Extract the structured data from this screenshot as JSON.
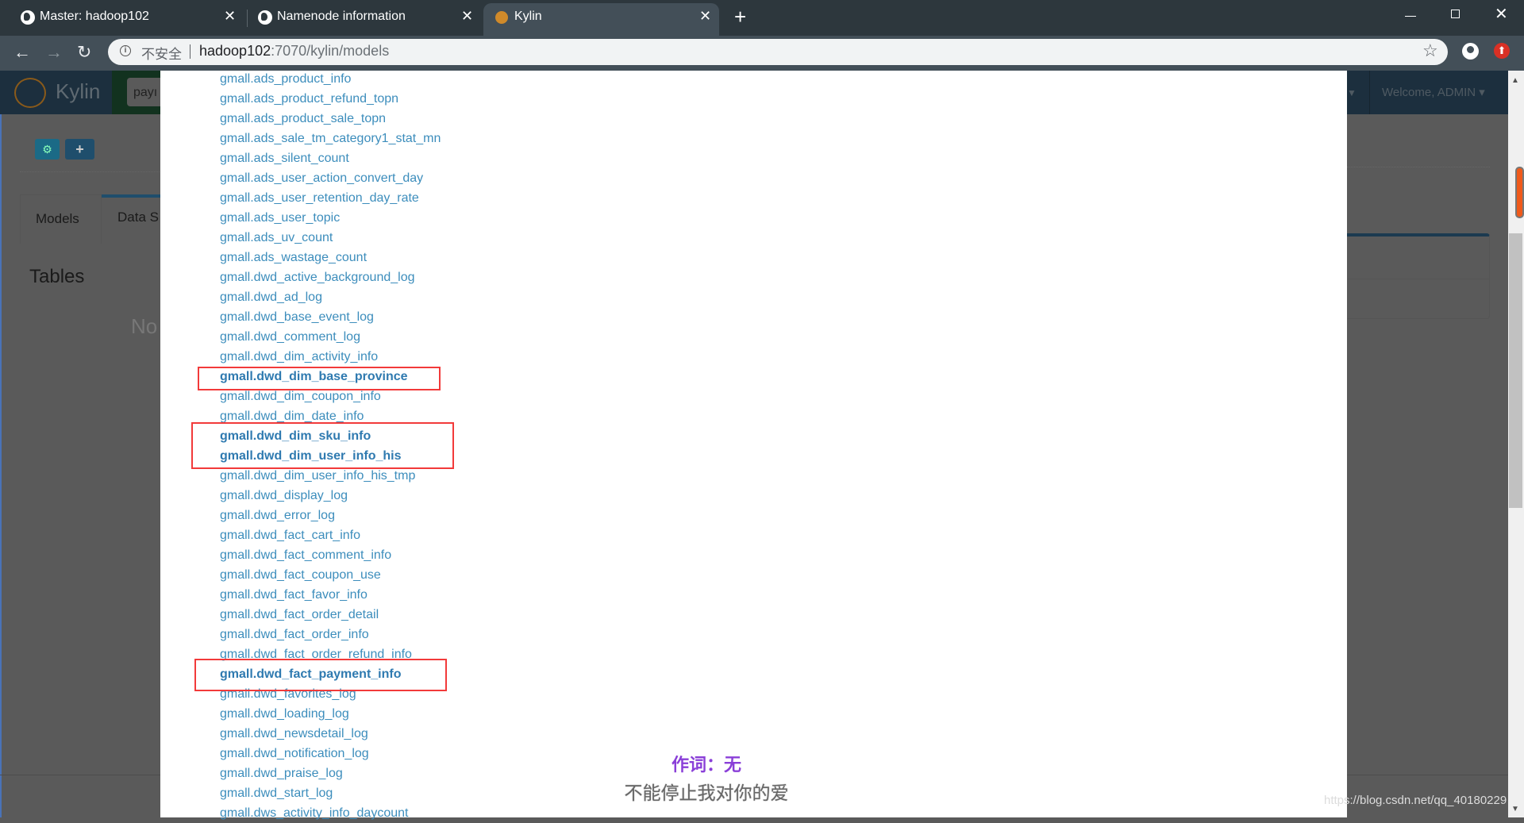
{
  "browser": {
    "tabs": [
      {
        "title": "Master: hadoop102",
        "icon": "globe-icon",
        "close": "✕"
      },
      {
        "title": "Namenode information",
        "icon": "globe-icon",
        "close": "✕"
      },
      {
        "title": "Kylin",
        "icon": "kylin-logo-icon",
        "close": "✕",
        "active": true
      }
    ],
    "new_tab": "+",
    "security_label": "不安全",
    "url_host": "hadoop102",
    "url_path": ":7070/kylin/models"
  },
  "kylin": {
    "brand": "Kylin",
    "project_select": "payı",
    "welcome": "Welcome, ADMIN",
    "tabs": [
      "Models",
      "Data S"
    ],
    "tables_heading": "Tables",
    "no_text": "No"
  },
  "table_list": [
    {
      "name": "gmall.ads_product_info"
    },
    {
      "name": "gmall.ads_product_refund_topn"
    },
    {
      "name": "gmall.ads_product_sale_topn"
    },
    {
      "name": "gmall.ads_sale_tm_category1_stat_mn"
    },
    {
      "name": "gmall.ads_silent_count"
    },
    {
      "name": "gmall.ads_user_action_convert_day"
    },
    {
      "name": "gmall.ads_user_retention_day_rate"
    },
    {
      "name": "gmall.ads_user_topic"
    },
    {
      "name": "gmall.ads_uv_count"
    },
    {
      "name": "gmall.ads_wastage_count"
    },
    {
      "name": "gmall.dwd_active_background_log"
    },
    {
      "name": "gmall.dwd_ad_log"
    },
    {
      "name": "gmall.dwd_base_event_log"
    },
    {
      "name": "gmall.dwd_comment_log"
    },
    {
      "name": "gmall.dwd_dim_activity_info"
    },
    {
      "name": "gmall.dwd_dim_base_province",
      "selected": true
    },
    {
      "name": "gmall.dwd_dim_coupon_info"
    },
    {
      "name": "gmall.dwd_dim_date_info"
    },
    {
      "name": "gmall.dwd_dim_sku_info",
      "selected": true
    },
    {
      "name": "gmall.dwd_dim_user_info_his",
      "selected": true
    },
    {
      "name": "gmall.dwd_dim_user_info_his_tmp"
    },
    {
      "name": "gmall.dwd_display_log"
    },
    {
      "name": "gmall.dwd_error_log"
    },
    {
      "name": "gmall.dwd_fact_cart_info"
    },
    {
      "name": "gmall.dwd_fact_comment_info"
    },
    {
      "name": "gmall.dwd_fact_coupon_use"
    },
    {
      "name": "gmall.dwd_fact_favor_info"
    },
    {
      "name": "gmall.dwd_fact_order_detail"
    },
    {
      "name": "gmall.dwd_fact_order_info"
    },
    {
      "name": "gmall.dwd_fact_order_refund_info"
    },
    {
      "name": "gmall.dwd_fact_payment_info",
      "selected": true
    },
    {
      "name": "gmall.dwd_favorites_log"
    },
    {
      "name": "gmall.dwd_loading_log"
    },
    {
      "name": "gmall.dwd_newsdetail_log"
    },
    {
      "name": "gmall.dwd_notification_log"
    },
    {
      "name": "gmall.dwd_praise_log"
    },
    {
      "name": "gmall.dwd_start_log"
    },
    {
      "name": "gmall.dws_activity_info_daycount"
    }
  ],
  "subtitles": {
    "line1": "作词：无",
    "line2": "不能停止我对你的爱"
  },
  "watermark": "https://blog.csdn.net/qq_40180229",
  "colors": {
    "link": "#3c8dbc",
    "highlight_box": "#f23a3a",
    "overlay": "#5a5a5a",
    "header": "#1c2f3e"
  }
}
